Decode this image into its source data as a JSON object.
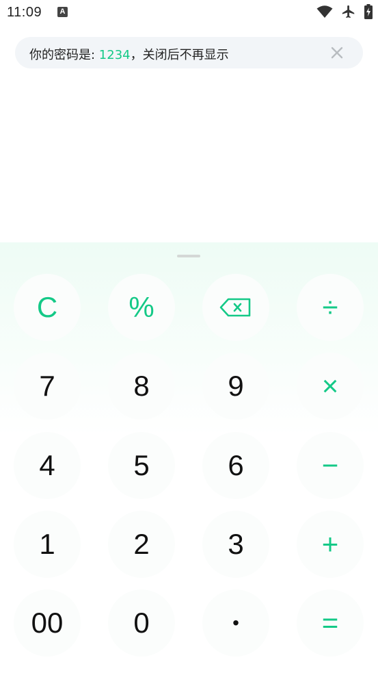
{
  "status_bar": {
    "time": "11:09",
    "notification_icon": "A",
    "icons": [
      "wifi-icon",
      "airplane-mode-icon",
      "battery-charging-icon"
    ]
  },
  "toast": {
    "text_prefix": "你的密码是: ",
    "password": "1234",
    "text_suffix": "，关闭后不再显示",
    "close_icon": "close-icon"
  },
  "keypad": {
    "accent_color": "#14c987",
    "keys": {
      "clear": "C",
      "percent": "%",
      "backspace_icon": "backspace-icon",
      "divide": "÷",
      "seven": "7",
      "eight": "8",
      "nine": "9",
      "multiply": "×",
      "four": "4",
      "five": "5",
      "six": "6",
      "minus": "−",
      "one": "1",
      "two": "2",
      "three": "3",
      "plus": "+",
      "double_zero": "00",
      "zero": "0",
      "dot": "•",
      "equals": "="
    }
  }
}
